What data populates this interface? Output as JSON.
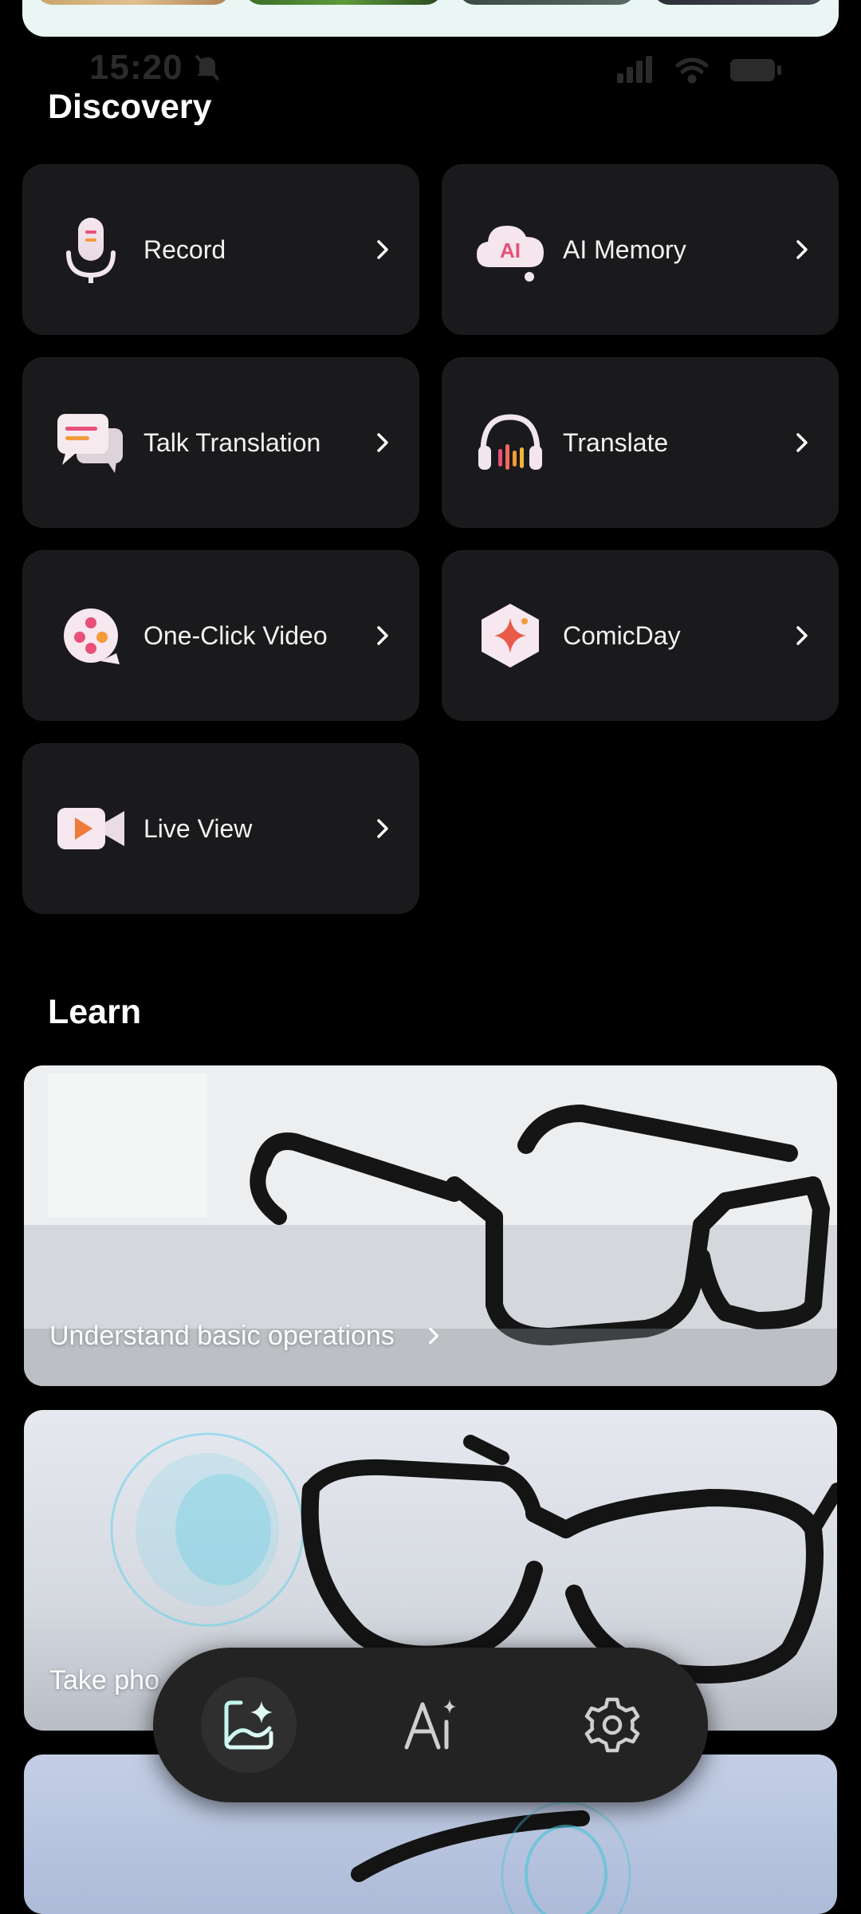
{
  "status_bar": {
    "time": "15:20"
  },
  "discovery": {
    "title": "Discovery",
    "items": [
      {
        "label": "Record",
        "icon": "microphone-icon"
      },
      {
        "label": "AI Memory",
        "icon": "ai-memory-cloud-icon",
        "icon_text": "AI"
      },
      {
        "label": "Talk Translation",
        "icon": "chat-bubbles-icon"
      },
      {
        "label": "Translate",
        "icon": "headphones-icon"
      },
      {
        "label": "One-Click Video",
        "icon": "film-reel-icon"
      },
      {
        "label": "ComicDay",
        "icon": "sparkle-hexagon-icon"
      },
      {
        "label": "Live View",
        "icon": "video-camera-icon"
      }
    ]
  },
  "learn": {
    "title": "Learn",
    "cards": [
      {
        "label": "Understand basic operations"
      },
      {
        "label": "Take pho"
      }
    ]
  },
  "nav": {
    "items": [
      {
        "icon": "gallery-sparkle-icon",
        "active": true
      },
      {
        "icon": "ai-icon",
        "active": false
      },
      {
        "icon": "gear-icon",
        "active": false
      }
    ]
  },
  "colors": {
    "background": "#000000",
    "tile": "#1a1a1c",
    "navbar": "#232323",
    "accent_pink": "#e8507a",
    "accent_orange": "#f39a3c"
  }
}
